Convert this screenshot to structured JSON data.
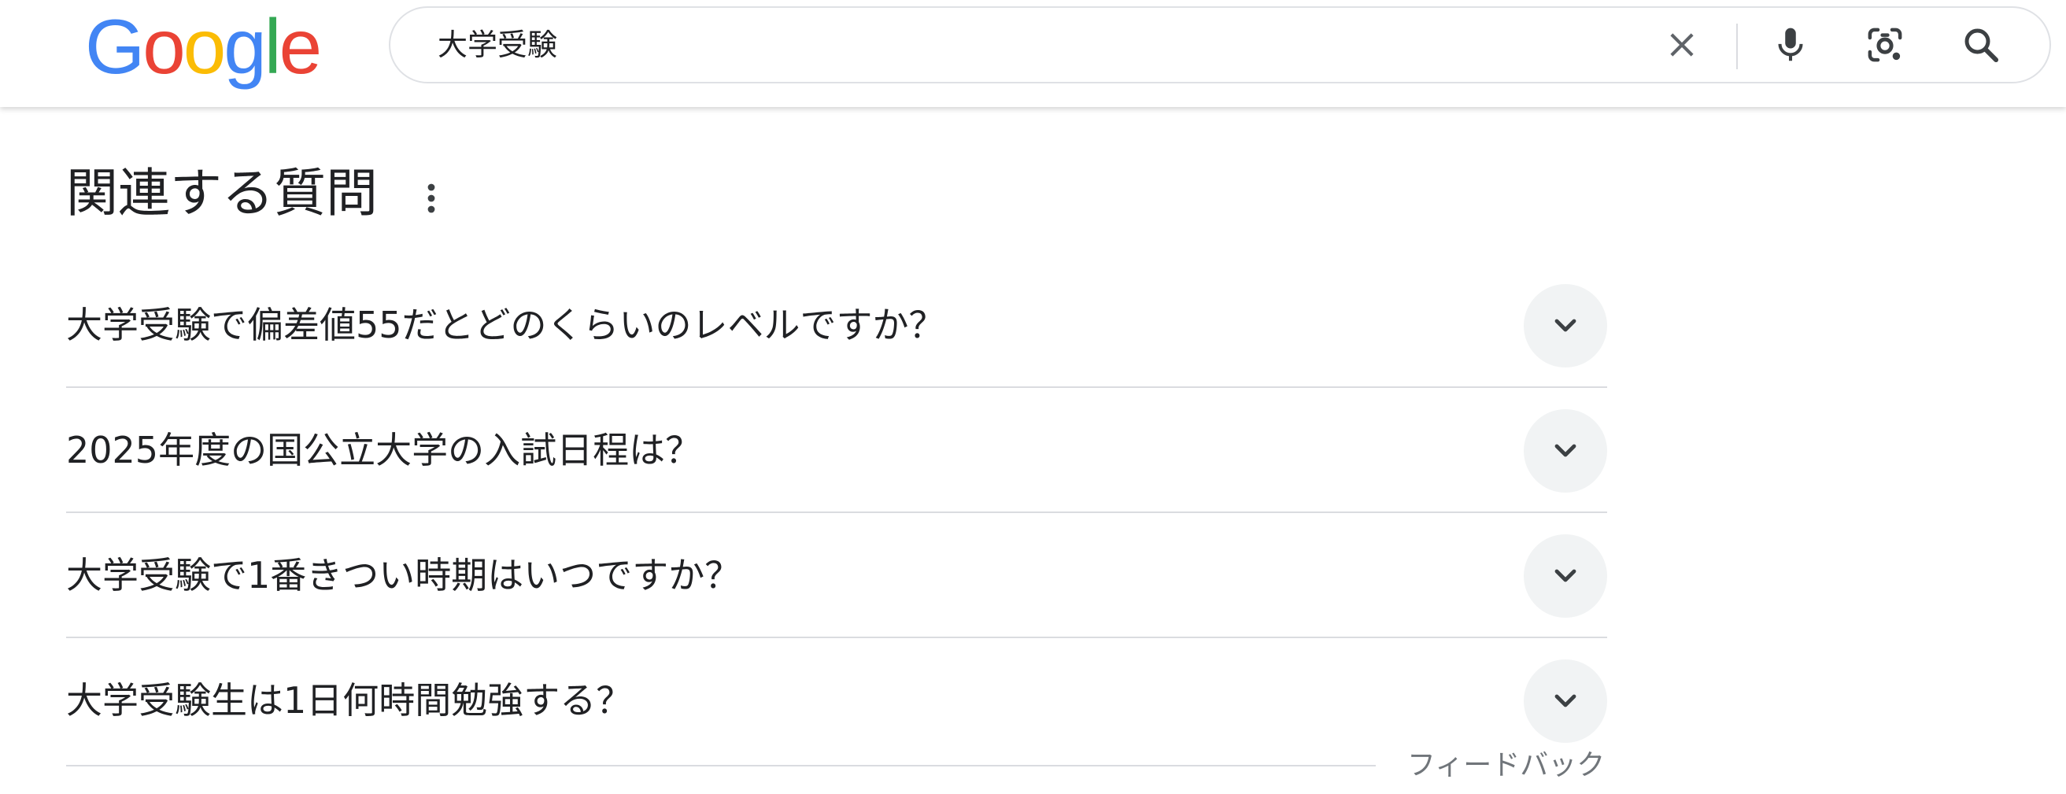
{
  "header": {
    "logo_letters": [
      "G",
      "o",
      "o",
      "g",
      "l",
      "e"
    ],
    "search": {
      "value": "大学受験"
    },
    "icons": {
      "clear": "close-icon",
      "voice": "mic-icon",
      "image": "lens-icon",
      "search": "search-icon"
    }
  },
  "people_also_ask": {
    "title": "関連する質問",
    "questions": [
      {
        "text": "大学受験で偏差値55だとどのくらいのレベルですか？"
      },
      {
        "text": "2025年度の国公立大学の入試日程は？"
      },
      {
        "text": "大学受験で1番きつい時期はいつですか？"
      },
      {
        "text": "大学受験生は1日何時間勉強する？"
      }
    ],
    "feedback_label": "フィードバック"
  },
  "colors": {
    "google_blue": "#4285f4",
    "google_red": "#ea4335",
    "google_yellow": "#fbbc05",
    "google_green": "#34a853",
    "text_primary": "#202124",
    "text_secondary": "#70757a",
    "divider": "#dadce0",
    "chevron_bg": "#f1f3f4"
  }
}
